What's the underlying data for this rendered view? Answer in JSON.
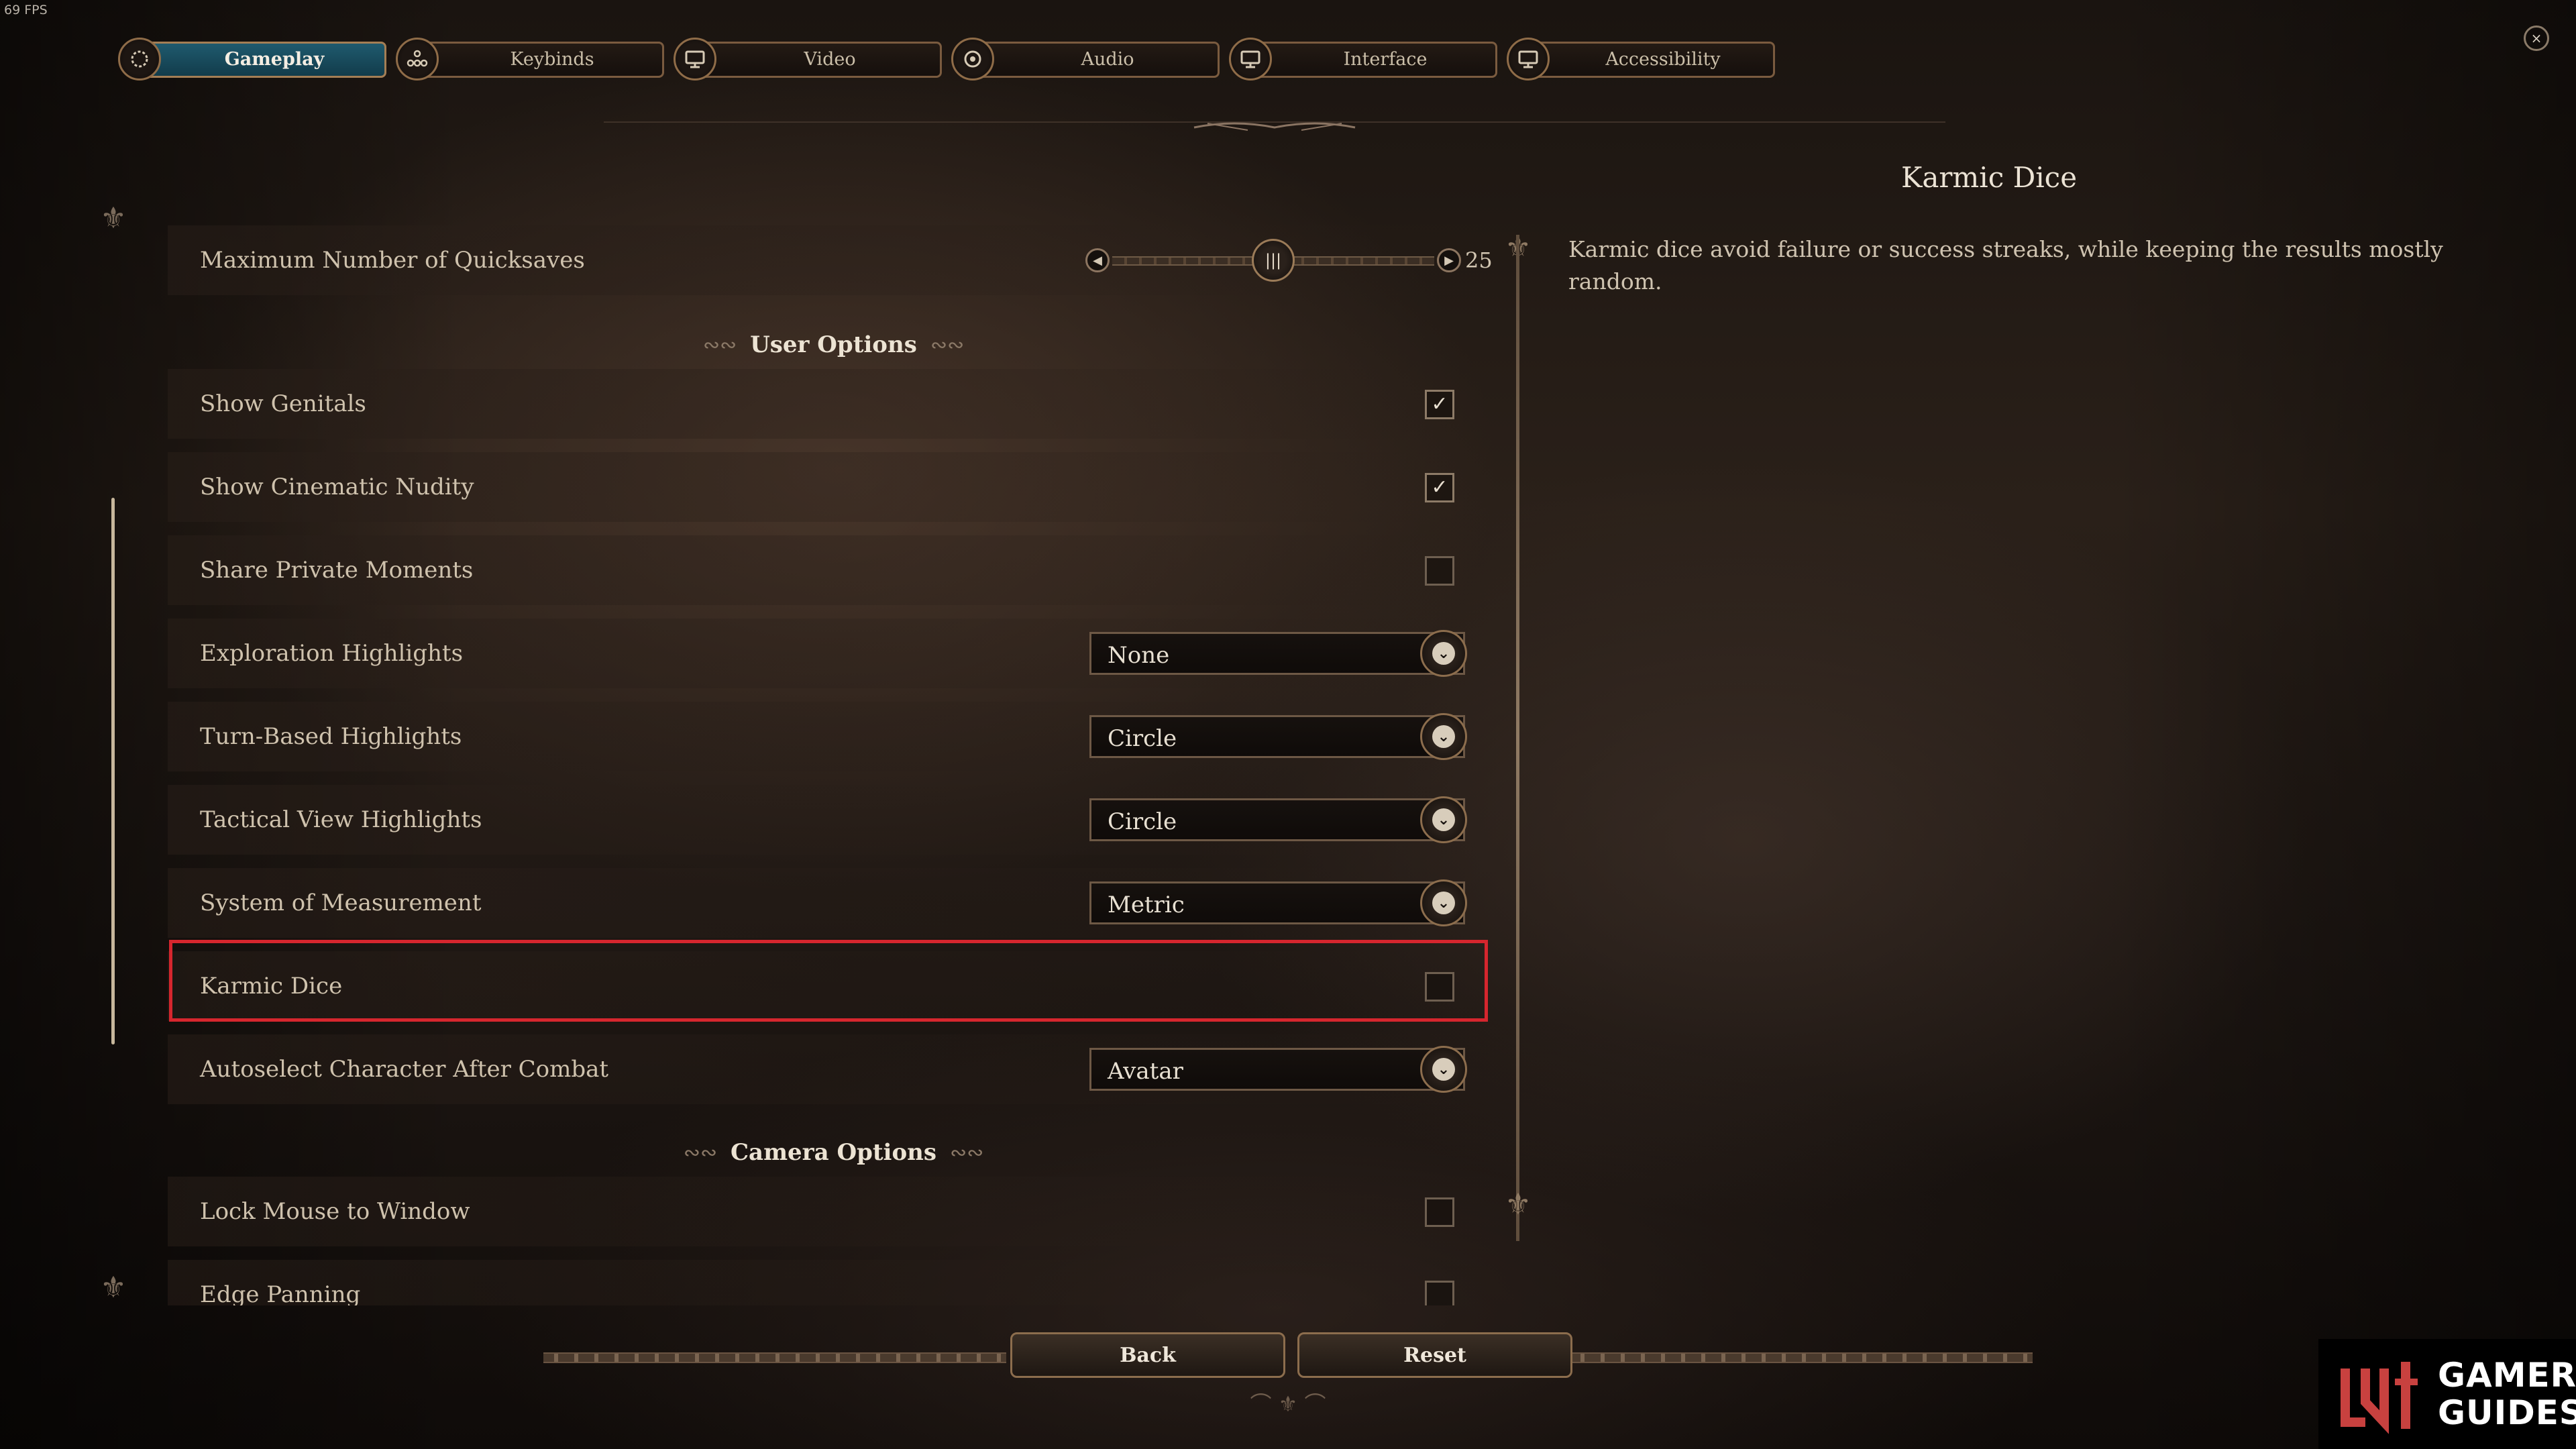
{
  "hud": {
    "fps": "69 FPS"
  },
  "tabs": [
    {
      "label": "Gameplay",
      "icon": "gear-icon",
      "active": true
    },
    {
      "label": "Keybinds",
      "icon": "controls-icon",
      "active": false
    },
    {
      "label": "Video",
      "icon": "monitor-icon",
      "active": false
    },
    {
      "label": "Audio",
      "icon": "speaker-icon",
      "active": false
    },
    {
      "label": "Interface",
      "icon": "monitor-icon",
      "active": false
    },
    {
      "label": "Accessibility",
      "icon": "monitor-icon",
      "active": false
    }
  ],
  "close": {
    "label": "×"
  },
  "settings": {
    "quicksaves": {
      "label": "Maximum Number of Quicksaves",
      "value": "25",
      "fraction": 0.5
    },
    "user_options_header": "User Options",
    "show_genitals": {
      "label": "Show Genitals",
      "checked": true
    },
    "show_cinematic_nudity": {
      "label": "Show Cinematic Nudity",
      "checked": true
    },
    "share_private_moments": {
      "label": "Share Private Moments",
      "checked": false
    },
    "exploration_highlights": {
      "label": "Exploration Highlights",
      "value": "None"
    },
    "turn_based_highlights": {
      "label": "Turn-Based Highlights",
      "value": "Circle"
    },
    "tactical_view_highlights": {
      "label": "Tactical View Highlights",
      "value": "Circle"
    },
    "system_of_measurement": {
      "label": "System of Measurement",
      "value": "Metric"
    },
    "karmic_dice": {
      "label": "Karmic Dice",
      "checked": false
    },
    "autoselect_character": {
      "label": "Autoselect Character After Combat",
      "value": "Avatar"
    },
    "camera_options_header": "Camera Options",
    "lock_mouse": {
      "label": "Lock Mouse to Window",
      "checked": false
    },
    "edge_panning": {
      "label": "Edge Panning",
      "checked": false
    }
  },
  "description": {
    "title": "Karmic Dice",
    "text": "Karmic dice avoid failure or success streaks, while keeping the results mostly random."
  },
  "buttons": {
    "back": "Back",
    "reset": "Reset"
  },
  "watermark": {
    "line1": "GAMER",
    "line2": "GUIDES"
  },
  "colors": {
    "accent_tab": "#1f5a6e",
    "highlight_border": "#d6262e",
    "text_primary": "#cfc2ad",
    "gold_border": "#8c6d4d"
  }
}
